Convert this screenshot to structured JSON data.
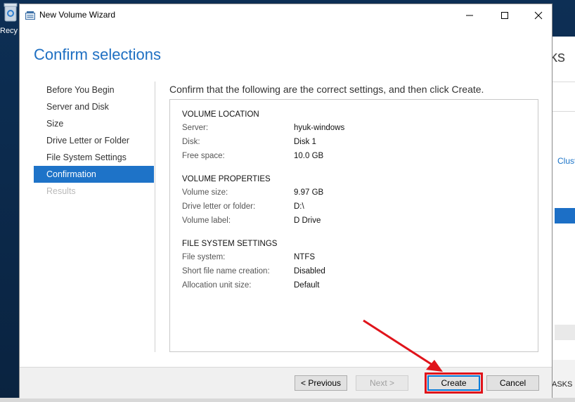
{
  "desktop": {
    "recycle_label": "Recy",
    "icon": "recycle-bin-icon"
  },
  "background_window": {
    "tasks_text": "sks",
    "clust_text": "Clust",
    "tasks_caps": "ASKS"
  },
  "window": {
    "title": "New Volume Wizard",
    "icon": "wizard-disk-icon",
    "controls": [
      "minimize-icon",
      "maximize-icon",
      "close-icon"
    ]
  },
  "page": {
    "heading": "Confirm selections",
    "instruction": "Confirm that the following are the correct settings, and then click Create."
  },
  "nav": {
    "items": [
      {
        "label": "Before You Begin",
        "state": "normal"
      },
      {
        "label": "Server and Disk",
        "state": "normal"
      },
      {
        "label": "Size",
        "state": "normal"
      },
      {
        "label": "Drive Letter or Folder",
        "state": "normal"
      },
      {
        "label": "File System Settings",
        "state": "normal"
      },
      {
        "label": "Confirmation",
        "state": "active"
      },
      {
        "label": "Results",
        "state": "disabled"
      }
    ]
  },
  "summary": {
    "volume_location": {
      "title": "VOLUME LOCATION",
      "rows": [
        {
          "key": "Server:",
          "value": "hyuk-windows"
        },
        {
          "key": "Disk:",
          "value": "Disk 1"
        },
        {
          "key": "Free space:",
          "value": "10.0 GB"
        }
      ]
    },
    "volume_properties": {
      "title": "VOLUME PROPERTIES",
      "rows": [
        {
          "key": "Volume size:",
          "value": "9.97 GB"
        },
        {
          "key": "Drive letter or folder:",
          "value": "D:\\"
        },
        {
          "key": "Volume label:",
          "value": "D Drive"
        }
      ]
    },
    "file_system_settings": {
      "title": "FILE SYSTEM SETTINGS",
      "rows": [
        {
          "key": "File system:",
          "value": "NTFS"
        },
        {
          "key": "Short file name creation:",
          "value": "Disabled"
        },
        {
          "key": "Allocation unit size:",
          "value": "Default"
        }
      ]
    }
  },
  "buttons": {
    "previous": "< Previous",
    "next": "Next >",
    "create": "Create",
    "cancel": "Cancel"
  },
  "annotation": {
    "color": "#e0141b"
  }
}
